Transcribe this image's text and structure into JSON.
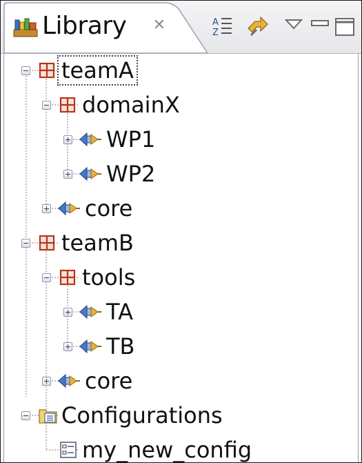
{
  "view": {
    "title": "Library",
    "close_glyph": "✕",
    "toolbar": [
      {
        "name": "collapse-all-icon"
      },
      {
        "name": "link-with-editor-icon"
      },
      {
        "name": "view-menu-icon"
      },
      {
        "name": "minimize-icon"
      },
      {
        "name": "maximize-icon"
      }
    ]
  },
  "tree": [
    {
      "id": "teamA",
      "label": "teamA",
      "icon": "package-icon",
      "expander": "minus",
      "focused": true
    },
    {
      "id": "domainX",
      "label": "domainX",
      "icon": "package-icon",
      "expander": "minus"
    },
    {
      "id": "WP1",
      "label": "WP1",
      "icon": "plugin-icon",
      "expander": "plus"
    },
    {
      "id": "WP2",
      "label": "WP2",
      "icon": "plugin-icon",
      "expander": "plus"
    },
    {
      "id": "coreA",
      "label": "core",
      "icon": "plugin-icon",
      "expander": "plus"
    },
    {
      "id": "teamB",
      "label": "teamB",
      "icon": "package-icon",
      "expander": "minus"
    },
    {
      "id": "tools",
      "label": "tools",
      "icon": "package-icon",
      "expander": "minus"
    },
    {
      "id": "TA",
      "label": "TA",
      "icon": "plugin-icon",
      "expander": "plus"
    },
    {
      "id": "TB",
      "label": "TB",
      "icon": "plugin-icon",
      "expander": "plus"
    },
    {
      "id": "coreB",
      "label": "core",
      "icon": "plugin-icon",
      "expander": "plus"
    },
    {
      "id": "configurations",
      "label": "Configurations",
      "icon": "configurations-folder-icon",
      "expander": "minus"
    },
    {
      "id": "my_new_config",
      "label": "my_new_config",
      "icon": "configuration-icon",
      "expander": "none"
    }
  ],
  "colors": {
    "package": "#b5341e",
    "plugin_left": "#4a78c8",
    "plugin_right": "#e8b23a"
  }
}
